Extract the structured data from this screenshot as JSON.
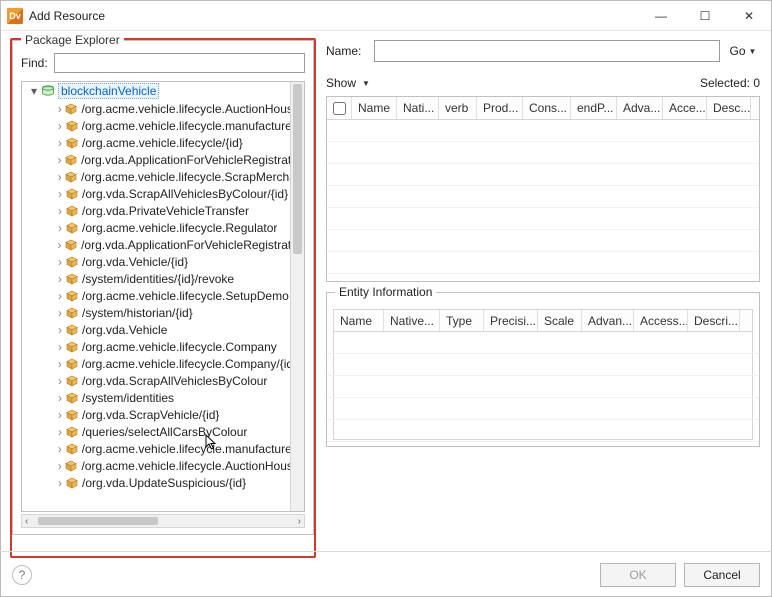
{
  "titlebar": {
    "app_icon_text": "Dv",
    "title": "Add Resource"
  },
  "left": {
    "legend": "Package Explorer",
    "find_label": "Find:",
    "find_value": "",
    "root": {
      "label": "blockchainVehicle"
    },
    "items": [
      "/org.acme.vehicle.lifecycle.AuctionHouse",
      "/org.acme.vehicle.lifecycle.manufacturer",
      "/org.acme.vehicle.lifecycle/{id}",
      "/org.vda.ApplicationForVehicleRegistration",
      "/org.acme.vehicle.lifecycle.ScrapMerchant",
      "/org.vda.ScrapAllVehiclesByColour/{id}",
      "/org.vda.PrivateVehicleTransfer",
      "/org.acme.vehicle.lifecycle.Regulator",
      "/org.vda.ApplicationForVehicleRegistration",
      "/org.vda.Vehicle/{id}",
      "/system/identities/{id}/revoke",
      "/org.acme.vehicle.lifecycle.SetupDemo",
      "/system/historian/{id}",
      "/org.vda.Vehicle",
      "/org.acme.vehicle.lifecycle.Company",
      "/org.acme.vehicle.lifecycle.Company/{id}",
      "/org.vda.ScrapAllVehiclesByColour",
      "/system/identities",
      "/org.vda.ScrapVehicle/{id}",
      "/queries/selectAllCarsByColour",
      "/org.acme.vehicle.lifecycle.manufacturer",
      "/org.acme.vehicle.lifecycle.AuctionHouse",
      "/org.vda.UpdateSuspicious/{id}"
    ]
  },
  "right": {
    "name_label": "Name:",
    "name_value": "",
    "go_label": "Go",
    "show_label": "Show",
    "selected_label": "Selected: 0",
    "table1_headers": [
      "Name",
      "Nati...",
      "verb",
      "Prod...",
      "Cons...",
      "endP...",
      "Adva...",
      "Acce...",
      "Desc..."
    ],
    "entity_info_legend": "Entity Information",
    "table2_headers": [
      "Name",
      "Native...",
      "Type",
      "Precisi...",
      "Scale",
      "Advan...",
      "Access...",
      "Descri..."
    ]
  },
  "footer": {
    "ok_label": "OK",
    "cancel_label": "Cancel"
  }
}
